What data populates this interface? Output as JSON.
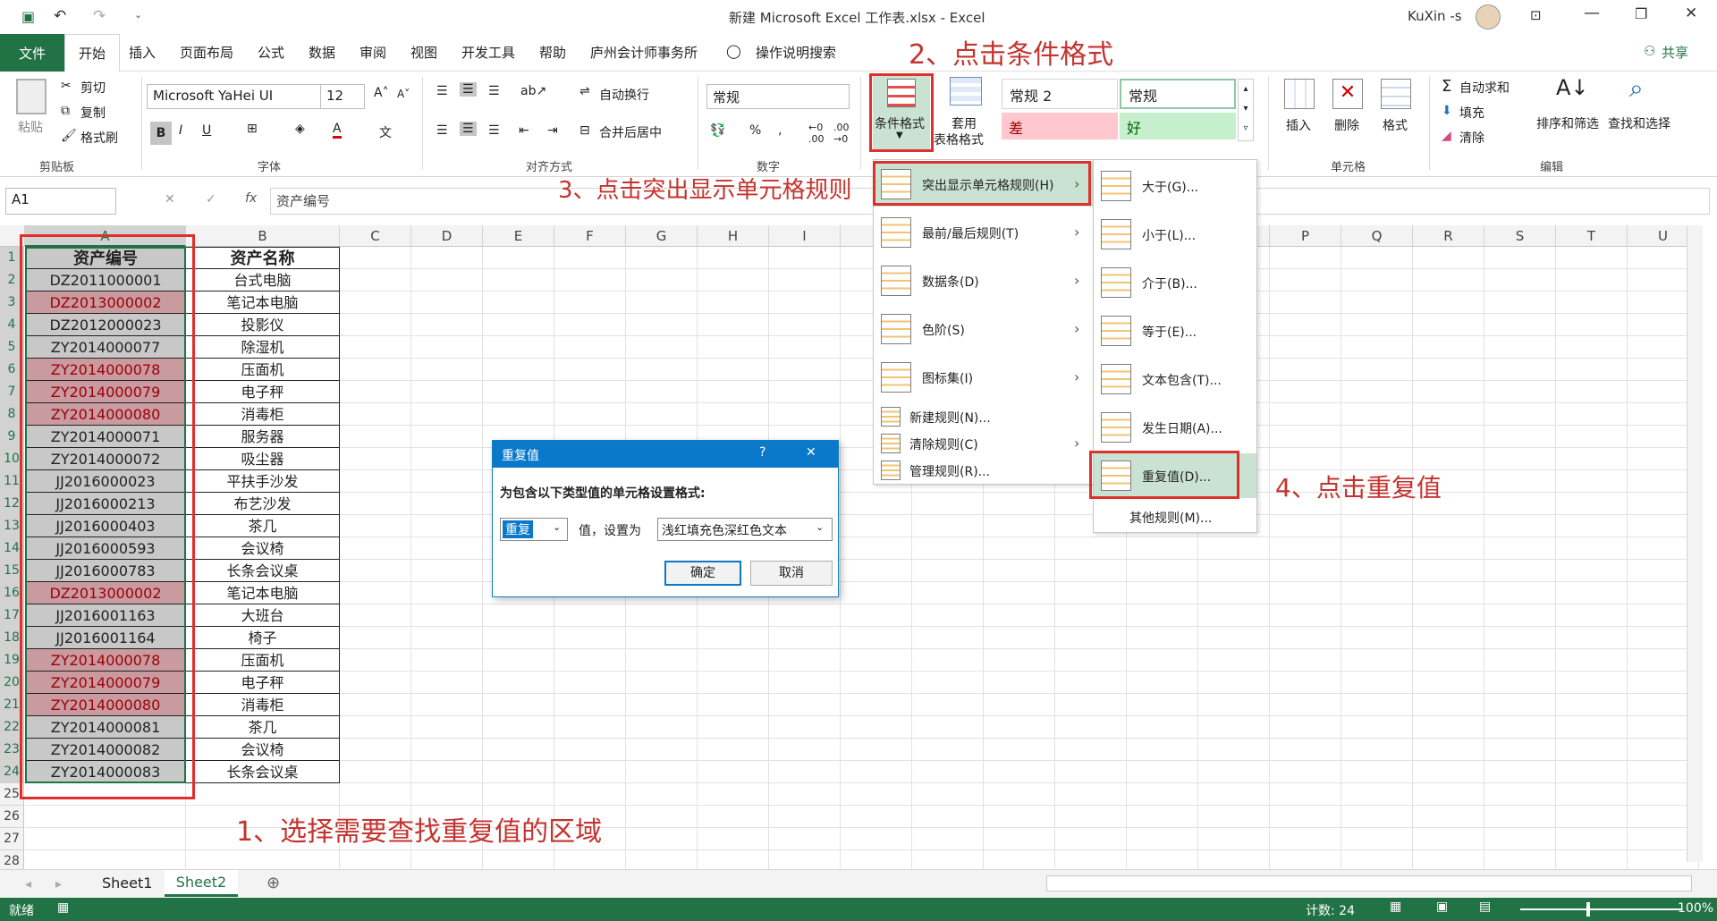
{
  "window": {
    "title": "新建 Microsoft Excel 工作表.xlsx  -  Excel",
    "user": "KuXin -s"
  },
  "tabs": [
    "文件",
    "开始",
    "插入",
    "页面布局",
    "公式",
    "数据",
    "审阅",
    "视图",
    "开发工具",
    "帮助",
    "庐州会计师事务所",
    "操作说明搜索"
  ],
  "share_label": "共享",
  "ribbon": {
    "clipboard": {
      "paste": "粘贴",
      "cut": "剪切",
      "copy": "复制",
      "painter": "格式刷",
      "label": "剪贴板"
    },
    "font": {
      "name": "Microsoft YaHei UI",
      "size": "12",
      "label": "字体"
    },
    "alignment": {
      "wrap": "自动换行",
      "merge": "合并后居中",
      "label": "对齐方式"
    },
    "number": {
      "format": "常规",
      "label": "数字"
    },
    "styles": {
      "conditional": "条件格式",
      "table_format_1": "套用",
      "table_format_2": "表格格式",
      "normal2": "常规 2",
      "normal": "常规",
      "bad": "差",
      "good": "好"
    },
    "cells": {
      "insert": "插入",
      "delete": "删除",
      "format": "格式",
      "label": "单元格"
    },
    "editing": {
      "autosum": "自动求和",
      "fill": "填充",
      "clear": "清除",
      "sort": "排序和筛选",
      "find": "查找和选择",
      "label": "编辑"
    }
  },
  "formula": {
    "name_box": "A1",
    "value": "资产编号"
  },
  "columns": [
    "A",
    "B",
    "C",
    "D",
    "E",
    "F",
    "G",
    "H",
    "I",
    "J",
    "K",
    "L",
    "M",
    "N",
    "O",
    "P",
    "Q",
    "R",
    "S",
    "T",
    "U"
  ],
  "headers": [
    "资产编号",
    "资产名称"
  ],
  "rows": [
    {
      "code": "DZ2011000001",
      "name": "台式电脑",
      "dup": false
    },
    {
      "code": "DZ2013000002",
      "name": "笔记本电脑",
      "dup": true
    },
    {
      "code": "DZ2012000023",
      "name": "投影仪",
      "dup": false
    },
    {
      "code": "ZY2014000077",
      "name": "除湿机",
      "dup": false
    },
    {
      "code": "ZY2014000078",
      "name": "压面机",
      "dup": true
    },
    {
      "code": "ZY2014000079",
      "name": "电子秤",
      "dup": true
    },
    {
      "code": "ZY2014000080",
      "name": "消毒柜",
      "dup": true
    },
    {
      "code": "ZY2014000071",
      "name": "服务器",
      "dup": false
    },
    {
      "code": "ZY2014000072",
      "name": "吸尘器",
      "dup": false
    },
    {
      "code": "JJ2016000023",
      "name": "平扶手沙发",
      "dup": false
    },
    {
      "code": "JJ2016000213",
      "name": "布艺沙发",
      "dup": false
    },
    {
      "code": "JJ2016000403",
      "name": "茶几",
      "dup": false
    },
    {
      "code": "JJ2016000593",
      "name": "会议椅",
      "dup": false
    },
    {
      "code": "JJ2016000783",
      "name": "长条会议桌",
      "dup": false
    },
    {
      "code": "DZ2013000002",
      "name": "笔记本电脑",
      "dup": true
    },
    {
      "code": "JJ2016001163",
      "name": "大班台",
      "dup": false
    },
    {
      "code": "JJ2016001164",
      "name": "椅子",
      "dup": false
    },
    {
      "code": "ZY2014000078",
      "name": "压面机",
      "dup": true
    },
    {
      "code": "ZY2014000079",
      "name": "电子秤",
      "dup": true
    },
    {
      "code": "ZY2014000080",
      "name": "消毒柜",
      "dup": true
    },
    {
      "code": "ZY2014000081",
      "name": "茶几",
      "dup": false
    },
    {
      "code": "ZY2014000082",
      "name": "会议椅",
      "dup": false
    },
    {
      "code": "ZY2014000083",
      "name": "长条会议桌",
      "dup": false
    }
  ],
  "row_numbers": [
    "1",
    "2",
    "3",
    "4",
    "5",
    "6",
    "7",
    "8",
    "9",
    "10",
    "11",
    "12",
    "13",
    "14",
    "15",
    "16",
    "17",
    "18",
    "19",
    "20",
    "21",
    "22",
    "23",
    "24",
    "25",
    "26",
    "27",
    "28"
  ],
  "menu1": [
    {
      "label": "突出显示单元格规则(H)",
      "arrow": "›"
    },
    {
      "label": "最前/最后规则(T)",
      "arrow": "›"
    },
    {
      "label": "数据条(D)",
      "arrow": "›"
    },
    {
      "label": "色阶(S)",
      "arrow": "›"
    },
    {
      "label": "图标集(I)",
      "arrow": "›"
    },
    {
      "label": "新建规则(N)...",
      "arrow": ""
    },
    {
      "label": "清除规则(C)",
      "arrow": "›"
    },
    {
      "label": "管理规则(R)...",
      "arrow": ""
    }
  ],
  "menu2": [
    "大于(G)...",
    "小于(L)...",
    "介于(B)...",
    "等于(E)...",
    "文本包含(T)...",
    "发生日期(A)...",
    "重复值(D)...",
    "其他规则(M)..."
  ],
  "dialog": {
    "title": "重复值",
    "help": "?",
    "close": "✕",
    "prompt": "为包含以下类型值的单元格设置格式:",
    "type_value": "重复",
    "middle": "值，设置为",
    "format_value": "浅红填充色深红色文本",
    "ok": "确定",
    "cancel": "取消"
  },
  "annotations": {
    "step1": "1、选择需要查找重复值的区域",
    "step2": "2、点击条件格式",
    "step3": "3、点击突出显示单元格规则",
    "step4": "4、点击重复值"
  },
  "sheets": [
    "Sheet1",
    "Sheet2"
  ],
  "status": {
    "ready": "就绪",
    "count": "计数: 24",
    "zoom": "100%"
  },
  "colors": {
    "excel_green": "#217346",
    "annotation_red": "#e0302b",
    "dup_fill": "#c99a9f",
    "dup_text": "#9c0006",
    "selection_fill": "#c8c8c8"
  }
}
